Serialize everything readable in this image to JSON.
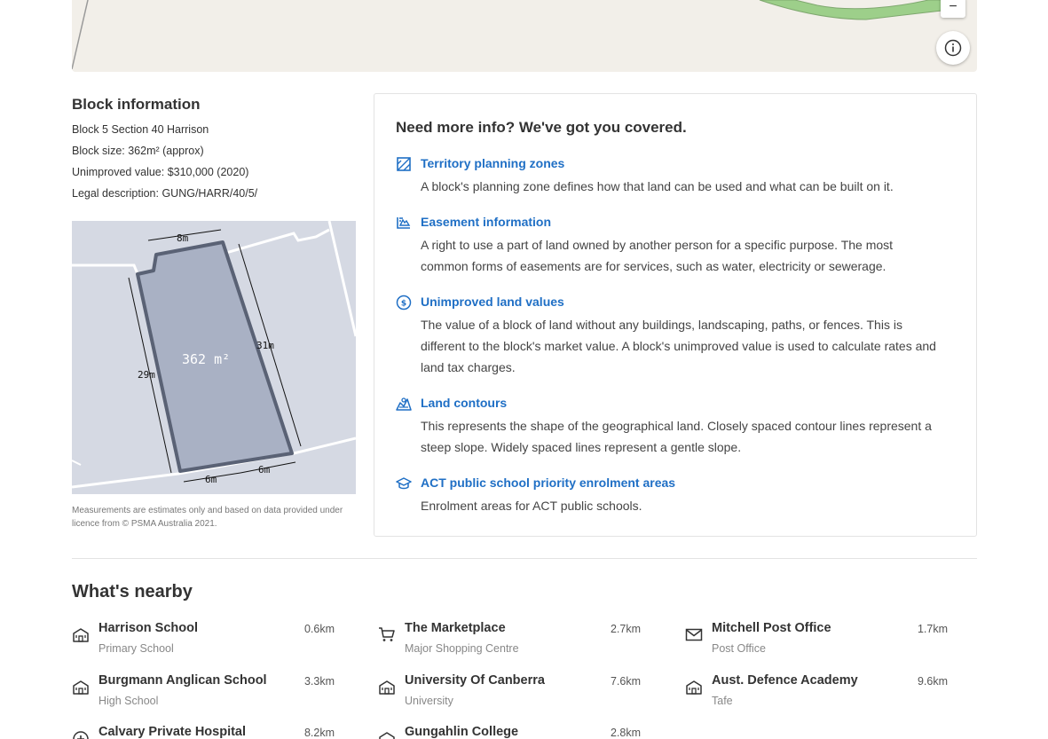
{
  "map": {
    "zoom_out_label": "−"
  },
  "block": {
    "heading": "Block information",
    "address": "Block 5 Section 40 Harrison",
    "size": "Block size: 362m² (approx)",
    "value": "Unimproved value: $310,000 (2020)",
    "legal": "Legal description: GUNG/HARR/40/5/",
    "plan_area": "362 m²",
    "dim_top": "8m",
    "dim_right": "31m",
    "dim_left": "29m",
    "dim_bottom_left": "6m",
    "dim_bottom_right": "6m",
    "disclaimer": "Measurements are estimates only and based on data provided under licence from © PSMA Australia 2021."
  },
  "info": {
    "heading": "Need more info? We've got you covered.",
    "items": [
      {
        "icon": "planning-zone-icon",
        "title": "Territory planning zones",
        "desc": "A block's planning zone defines how that land can be used and what can be built on it."
      },
      {
        "icon": "easement-icon",
        "title": "Easement information",
        "desc": "A right to use a part of land owned by another person for a specific purpose. The most common forms of easements are for services, such as water, electricity or sewerage."
      },
      {
        "icon": "dollar-icon",
        "title": "Unimproved land values",
        "desc": "The value of a block of land without any buildings, landscaping, paths, or fences. This is different to the block's market value. A block's unimproved value is used to calculate rates and land tax charges."
      },
      {
        "icon": "contour-icon",
        "title": "Land contours",
        "desc": "This represents the shape of the geographical land. Closely spaced contour lines represent a steep slope. Widely spaced lines represent a gentle slope."
      },
      {
        "icon": "graduation-cap-icon",
        "title": "ACT public school priority enrolment areas",
        "desc": "Enrolment areas for ACT public schools."
      }
    ]
  },
  "nearby": {
    "heading": "What's nearby",
    "items": [
      {
        "icon": "school-icon",
        "name": "Harrison School",
        "type": "Primary School",
        "dist": "0.6km"
      },
      {
        "icon": "cart-icon",
        "name": "The Marketplace",
        "type": "Major Shopping Centre",
        "dist": "2.7km"
      },
      {
        "icon": "mail-icon",
        "name": "Mitchell Post Office",
        "type": "Post Office",
        "dist": "1.7km"
      },
      {
        "icon": "school-icon",
        "name": "Burgmann Anglican School",
        "type": "High School",
        "dist": "3.3km"
      },
      {
        "icon": "school-icon",
        "name": "University Of Canberra",
        "type": "University",
        "dist": "7.6km"
      },
      {
        "icon": "school-icon",
        "name": "Aust. Defence Academy",
        "type": "Tafe",
        "dist": "9.6km"
      },
      {
        "icon": "hospital-icon",
        "name": "Calvary Private Hospital",
        "type": "",
        "dist": "8.2km"
      },
      {
        "icon": "school-icon",
        "name": "Gungahlin College",
        "type": "",
        "dist": "2.8km"
      }
    ]
  },
  "colors": {
    "link": "#1f6fc5",
    "plan_bg": "#d5d9e3",
    "block_fill": "#a9b1c4",
    "block_outline": "#5a6275"
  }
}
